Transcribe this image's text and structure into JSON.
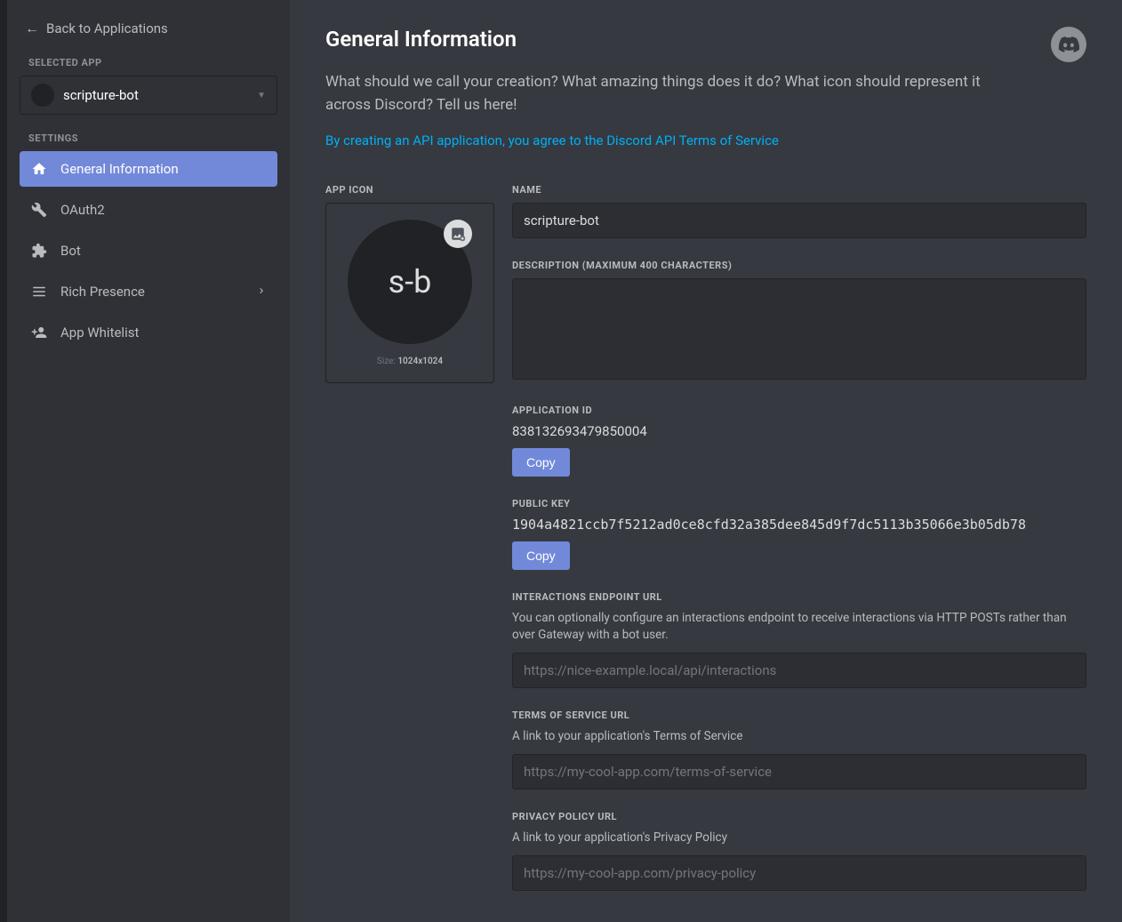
{
  "sidebar": {
    "back_label": "Back to Applications",
    "selected_app_label": "SELECTED APP",
    "selected_app_name": "scripture-bot",
    "settings_label": "SETTINGS",
    "items": [
      {
        "label": "General Information",
        "icon": "home"
      },
      {
        "label": "OAuth2",
        "icon": "wrench"
      },
      {
        "label": "Bot",
        "icon": "puzzle"
      },
      {
        "label": "Rich Presence",
        "icon": "list",
        "has_chevron": true
      },
      {
        "label": "App Whitelist",
        "icon": "person-add"
      }
    ]
  },
  "page": {
    "title": "General Information",
    "subtitle": "What should we call your creation? What amazing things does it do? What icon should represent it across Discord? Tell us here!",
    "tos_text": "By creating an API application, you agree to the Discord API Terms of Service"
  },
  "app_icon": {
    "label": "APP ICON",
    "initials": "s-b",
    "size_prefix": "Size: ",
    "size_value": "1024x1024"
  },
  "fields": {
    "name": {
      "label": "NAME",
      "value": "scripture-bot"
    },
    "description": {
      "label": "DESCRIPTION (MAXIMUM 400 CHARACTERS)",
      "value": ""
    },
    "app_id": {
      "label": "APPLICATION ID",
      "value": "838132693479850004",
      "copy": "Copy"
    },
    "public_key": {
      "label": "PUBLIC KEY",
      "value": "1904a4821ccb7f5212ad0ce8cfd32a385dee845d9f7dc5113b35066e3b05db78",
      "copy": "Copy"
    },
    "interactions": {
      "label": "INTERACTIONS ENDPOINT URL",
      "help": "You can optionally configure an interactions endpoint to receive interactions via HTTP POSTs rather than over Gateway with a bot user.",
      "placeholder": "https://nice-example.local/api/interactions"
    },
    "tos_url": {
      "label": "TERMS OF SERVICE URL",
      "help": "A link to your application's Terms of Service",
      "placeholder": "https://my-cool-app.com/terms-of-service"
    },
    "privacy_url": {
      "label": "PRIVACY POLICY URL",
      "help": "A link to your application's Privacy Policy",
      "placeholder": "https://my-cool-app.com/privacy-policy"
    }
  }
}
